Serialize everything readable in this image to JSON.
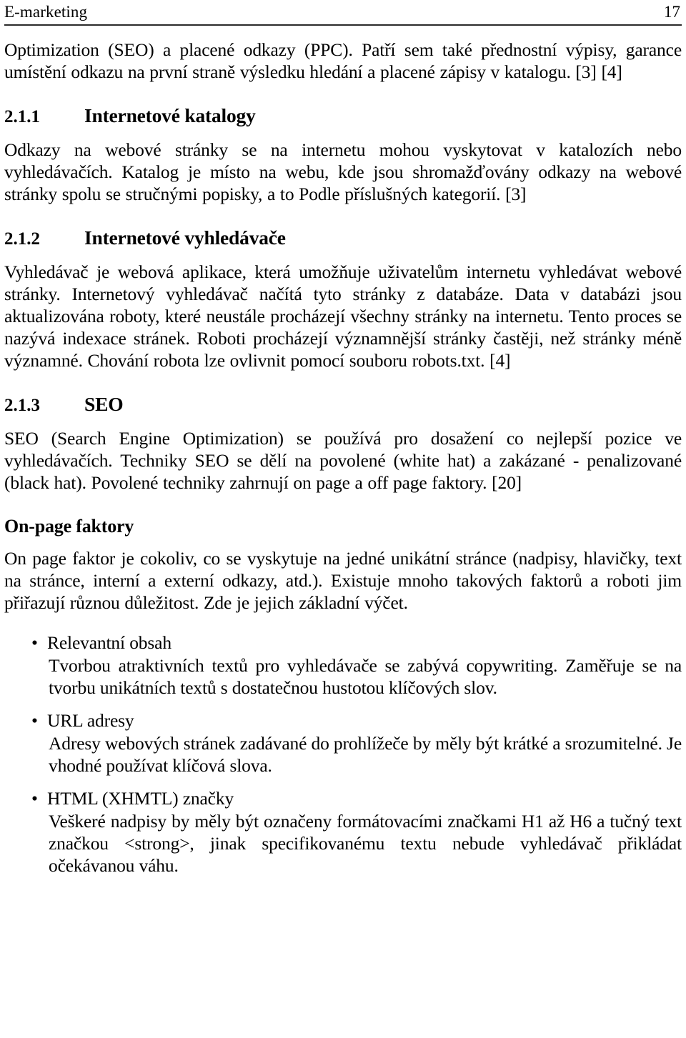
{
  "header": {
    "title": "E-marketing",
    "page_number": "17"
  },
  "body": {
    "intro_paragraph": "Optimization (SEO) a placené odkazy (PPC). Patří sem také přednostní výpisy, garance umístění odkazu na první straně výsledku hledání a placené zápisy v katalogu. [3] [4]",
    "sections": [
      {
        "number": "2.1.1",
        "title": "Internetové katalogy",
        "paragraph": "Odkazy na webové stránky se na internetu mohou vyskytovat v katalozích nebo vyhledávačích. Katalog je místo na webu, kde jsou shromažďovány odkazy na webové stránky spolu se stručnými popisky, a to Podle příslušných kategorií. [3]"
      },
      {
        "number": "2.1.2",
        "title": "Internetové vyhledávače",
        "paragraph": "Vyhledávač je webová aplikace, která umožňuje uživatelům internetu vyhledávat webové stránky. Internetový vyhledávač načítá tyto stránky z databáze. Data v databázi jsou aktualizována roboty, které neustále procházejí všechny stránky na internetu. Tento proces se nazývá indexace stránek. Roboti procházejí významnější stránky častěji, než stránky méně významné. Chování robota lze ovlivnit pomocí souboru robots.txt. [4]"
      },
      {
        "number": "2.1.3",
        "title": "SEO",
        "paragraph": "SEO (Search Engine Optimization) se používá pro dosažení co nejlepší pozice ve vyhledávačích. Techniky SEO se dělí na povolené (white hat) a zakázané - penalizované (black hat). Povolené techniky zahrnují on page a off page faktory. [20]"
      }
    ],
    "subsection": {
      "heading": "On-page faktory",
      "paragraph": "On page faktor je cokoliv, co se vyskytuje na jedné unikátní stránce (nadpisy, hlavičky, text na stránce, interní a externí odkazy, atd.). Existuje mnoho takových faktorů a roboti jim přiřazují různou důležitost. Zde je jejich základní výčet.",
      "bullet_marker": "•",
      "items": [
        {
          "label": "Relevantní obsah",
          "description": "Tvorbou atraktivních textů pro vyhledávače se zabývá copywriting. Zaměřuje se na tvorbu unikátních textů s dostatečnou hustotou klíčových slov."
        },
        {
          "label": "URL adresy",
          "description": "Adresy webových stránek zadávané do prohlížeče by měly být krátké a srozumitelné. Je vhodné používat klíčová slova."
        },
        {
          "label": "HTML (XHMTL) značky",
          "description": "Veškeré nadpisy by měly být označeny formátovacími značkami H1 až H6 a tučný text značkou <strong>, jinak specifikovanému textu nebude vyhledávač přikládat očekávanou váhu."
        }
      ]
    }
  }
}
